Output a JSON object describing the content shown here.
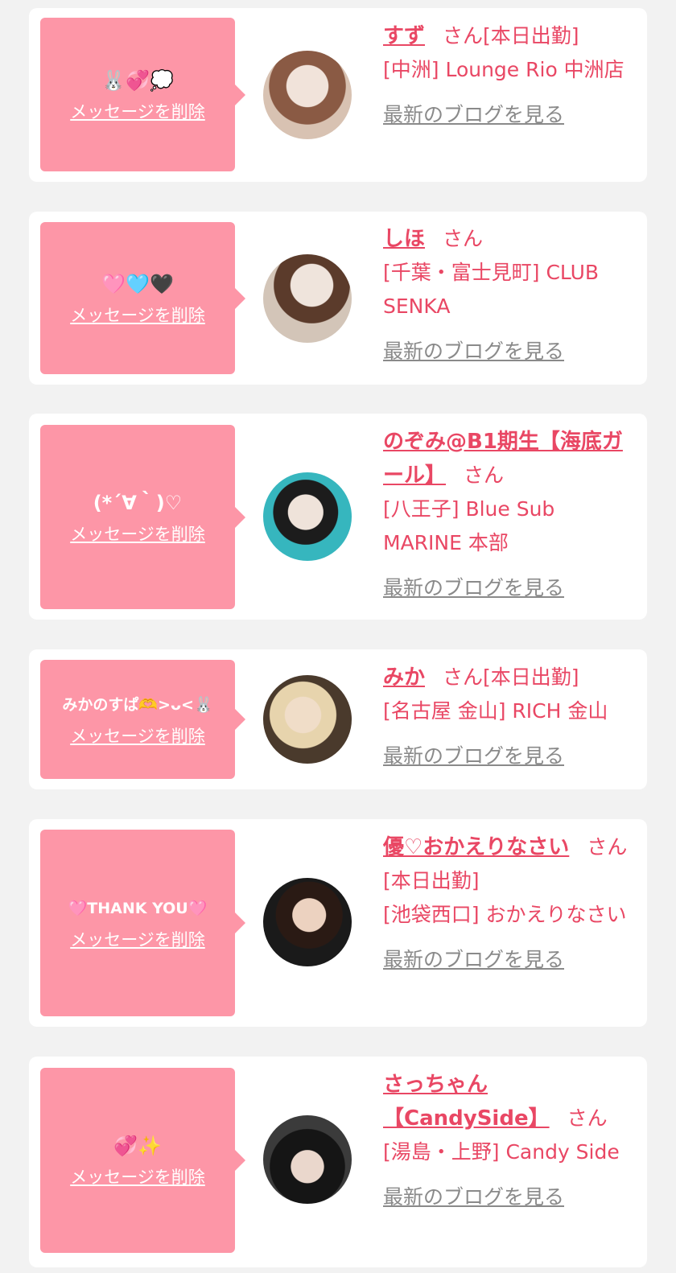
{
  "ui": {
    "delete_label": "メッセージを削除",
    "blog_label": "最新のブログを見る",
    "san_label": "さん"
  },
  "items": [
    {
      "message": "🐰💞💭",
      "name": "すず",
      "badge": "[本日出勤]",
      "shop": "[中洲] Lounge Rio 中洲店",
      "avatar_colors": [
        "#e8d3c6",
        "#7a4c3a"
      ]
    },
    {
      "message": "🩷🩵🖤",
      "name": "しほ",
      "badge": "",
      "shop": "[千葉・富士見町] CLUB SENKA",
      "avatar_colors": [
        "#d9cfc4",
        "#5a3c2c"
      ]
    },
    {
      "message": "(*´∀｀)♡",
      "name": "のぞみ@B1期生【海底ガール】",
      "badge": "",
      "shop": "[八王子] Blue Sub MARINE 本部",
      "avatar_colors": [
        "#2fb3bd",
        "#1b1b1b"
      ]
    },
    {
      "message": "みかのすぱ🫶>ᴗ<🐰",
      "name": "みか",
      "badge": "[本日出勤]",
      "shop": "[名古屋 金山] RICH 金山",
      "avatar_colors": [
        "#4a3a2a",
        "#e8d7b0"
      ]
    },
    {
      "message": "🩷THANK YOU🩷",
      "name": "優♡おかえりなさい",
      "badge": "[本日出勤]",
      "shop": "[池袋西口] おかえりなさい",
      "avatar_colors": [
        "#1a1a1a",
        "#8a6048"
      ]
    },
    {
      "message": "💞✨",
      "name": "さっちゃん【CandySide】",
      "badge": "",
      "shop": "[湯島・上野] Candy Side",
      "avatar_colors": [
        "#3a3a3a",
        "#101010"
      ]
    }
  ]
}
